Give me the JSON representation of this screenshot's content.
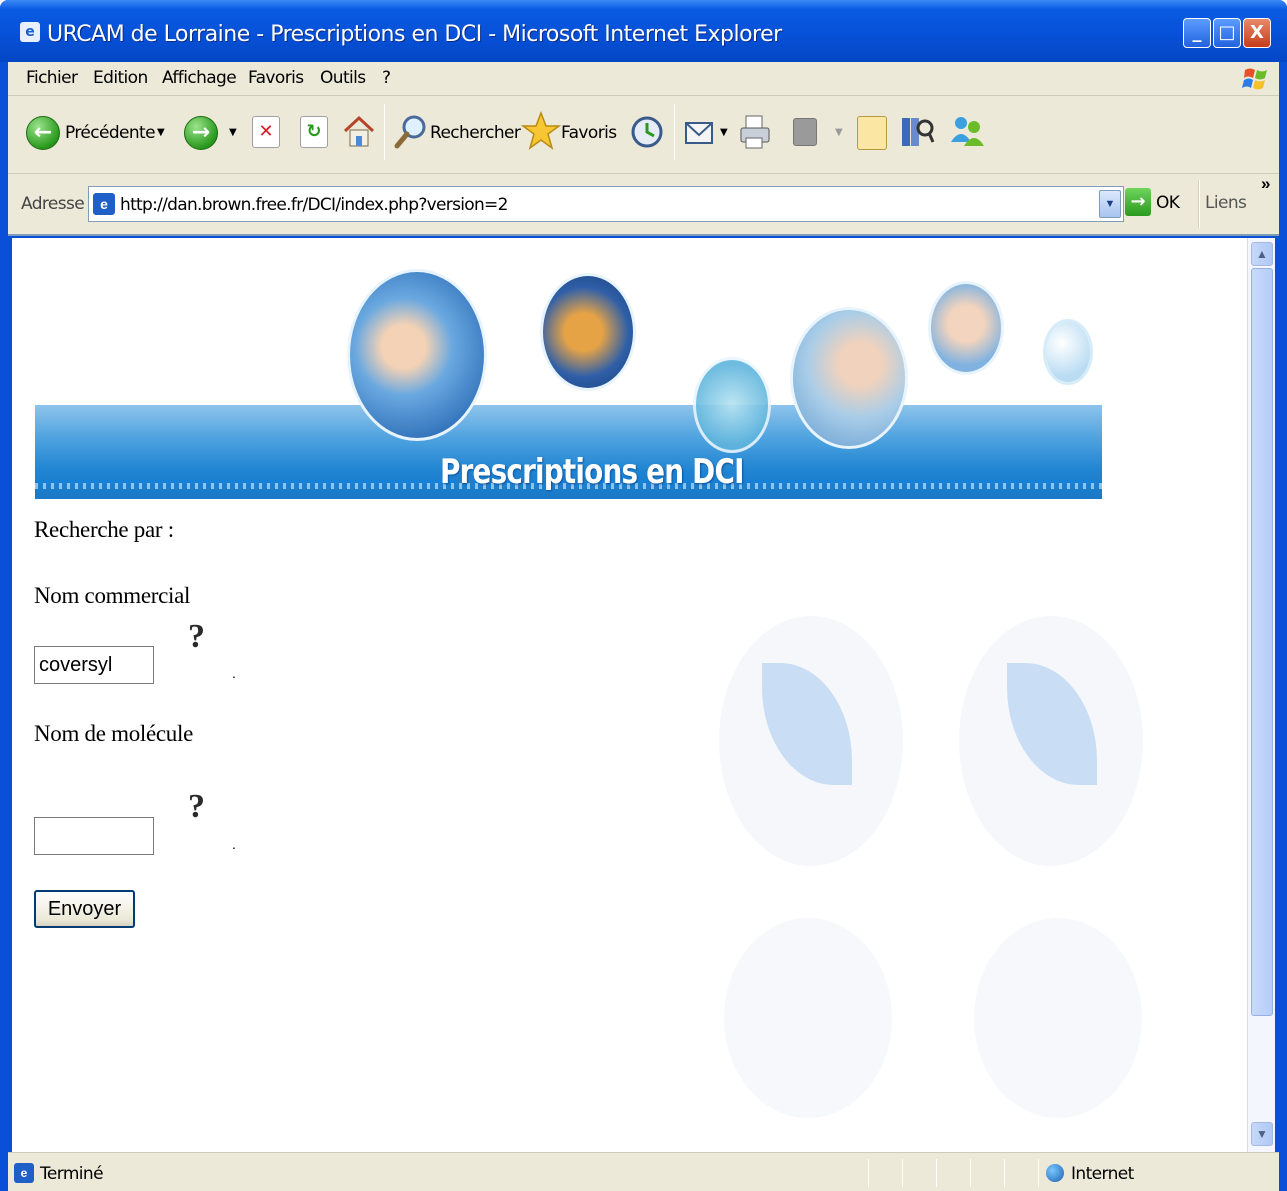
{
  "window": {
    "title": "URCAM de Lorraine - Prescriptions en DCI - Microsoft Internet Explorer",
    "controls": {
      "minimize": "_",
      "maximize": "□",
      "close": "X"
    }
  },
  "menu": {
    "items": [
      "Fichier",
      "Edition",
      "Affichage",
      "Favoris",
      "Outils",
      "?"
    ]
  },
  "toolbar": {
    "back_label": "Précédente",
    "search_label": "Rechercher",
    "favorites_label": "Favoris"
  },
  "address": {
    "label": "Adresse",
    "url": "http://dan.brown.free.fr/DCI/index.php?version=2",
    "go_label": "OK",
    "links_label": "Liens",
    "more": "»"
  },
  "page": {
    "banner_title": "Prescriptions en DCI",
    "search_by": "Recherche par :",
    "commercial_name_label": "Nom commercial",
    "commercial_name_value": "coversyl",
    "molecule_label": "Nom de molécule",
    "molecule_value": "",
    "help_glyph": "?",
    "submit_label": "Envoyer"
  },
  "status": {
    "text": "Terminé",
    "zone": "Internet"
  },
  "colors": {
    "titlebar": "#0650d6",
    "chrome": "#ece9d8",
    "banner_blue": "#1f84d2",
    "go_green": "#2a9a1e",
    "close_red": "#c63c1c"
  }
}
